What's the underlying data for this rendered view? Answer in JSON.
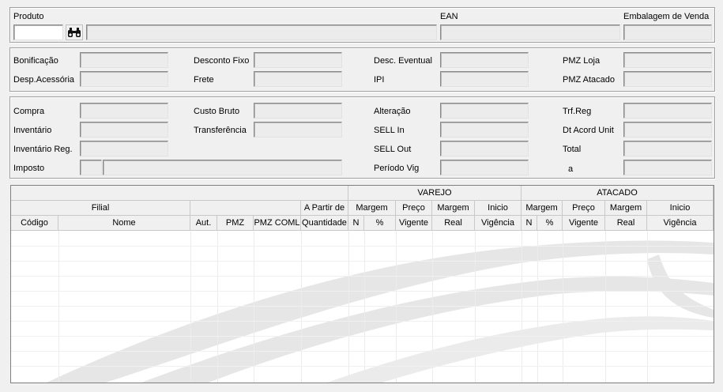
{
  "produto": {
    "label": "Produto",
    "ean_label": "EAN",
    "embalagem_label": "Embalagem de Venda",
    "search_icon": "binoculars-icon"
  },
  "custos": {
    "bonificacao": "Bonificação",
    "desp_acessoria": "Desp.Acessória",
    "desconto_fixo": "Desconto Fixo",
    "frete": "Frete",
    "desc_eventual": "Desc. Eventual",
    "ipi": "IPI",
    "pmz_loja": "PMZ Loja",
    "pmz_atacado": "PMZ Atacado"
  },
  "detalhes": {
    "compra": "Compra",
    "inventario": "Inventário",
    "inventario_reg": "Inventário Reg.",
    "imposto": "Imposto",
    "custo_bruto": "Custo Bruto",
    "transferencia": "Transferência",
    "alteracao": "Alteração",
    "sell_in": "SELL In",
    "sell_out": "SELL Out",
    "periodo_vig": "Período Vig",
    "periodo_a": "a",
    "trf_reg": "Trf.Reg",
    "dt_acord_unit": "Dt Acord Unit",
    "total": "Total"
  },
  "grid": {
    "group_varejo": "VAREJO",
    "group_atacado": "ATACADO",
    "filial": "Filial",
    "a_partir_de": "A Partir de",
    "v_margem": "Margem",
    "v_preco": "Preço",
    "v_margem2": "Margem",
    "v_inicio": "Inicio",
    "a_margem": "Margem",
    "a_preco": "Preço",
    "a_margem2": "Margem",
    "a_inicio": "Inicio",
    "columns": {
      "codigo": "Código",
      "nome": "Nome",
      "aut": "Aut.",
      "pmz": "PMZ",
      "pmz_coml": "PMZ COML",
      "quantidade": "Quantidade",
      "v_n": "N",
      "v_pct": "%",
      "v_vigente": "Vigente",
      "v_real": "Real",
      "v_vigencia": "Vigência",
      "a_n": "N",
      "a_pct": "%",
      "a_vigente": "Vigente",
      "a_real": "Real",
      "a_vigencia": "Vigência"
    }
  }
}
